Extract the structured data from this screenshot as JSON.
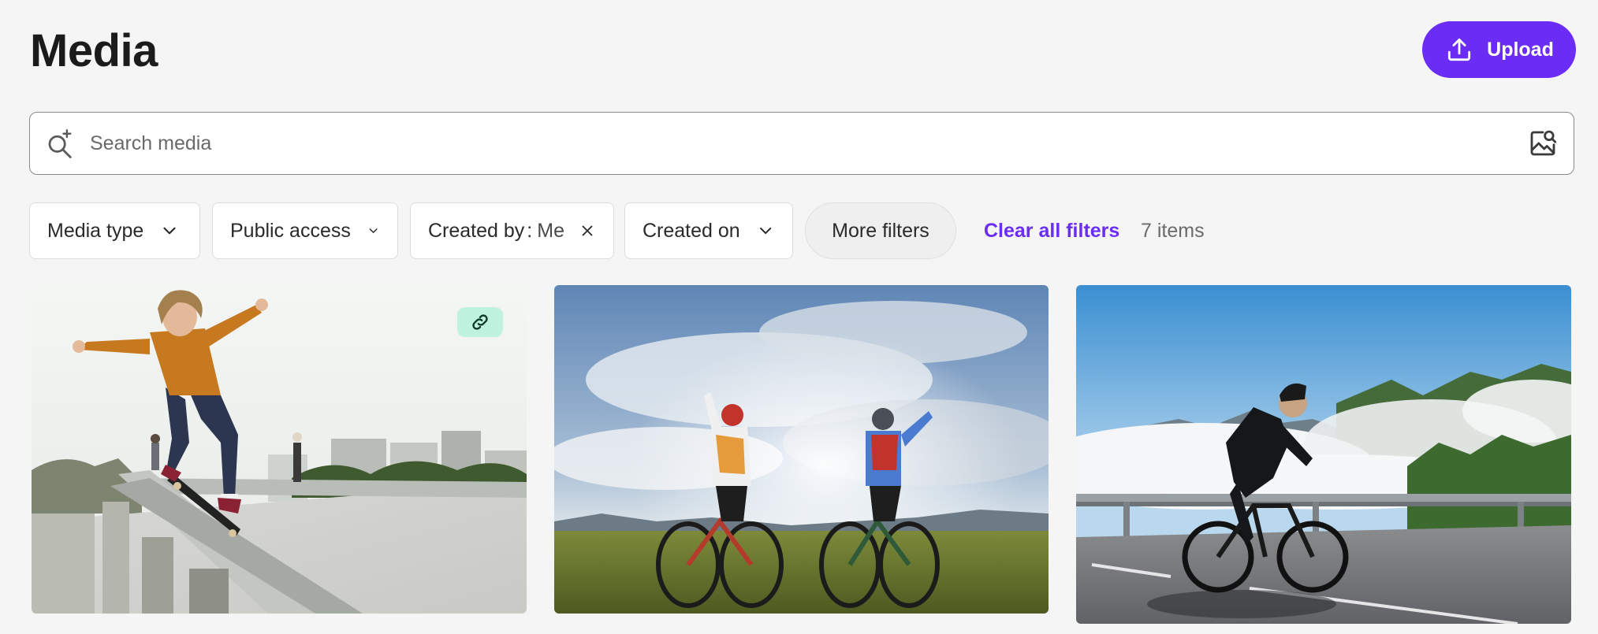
{
  "page": {
    "title": "Media"
  },
  "toolbar": {
    "upload_label": "Upload",
    "upload_icon": "upload-icon"
  },
  "search": {
    "placeholder": "Search media",
    "value": "",
    "leading_icon": "ai-search-icon",
    "trailing_icon": "image-search-icon"
  },
  "filters": {
    "media_type": {
      "label": "Media type",
      "icon": "chevron-down-icon"
    },
    "public_access": {
      "label": "Public access",
      "icon": "chevron-down-icon"
    },
    "created_by": {
      "label": "Created by",
      "separator": ":",
      "value": "Me",
      "icon": "close-icon"
    },
    "created_on": {
      "label": "Created on",
      "icon": "chevron-down-icon"
    },
    "more_filters": {
      "label": "More filters"
    },
    "clear_all": "Clear all filters",
    "item_count": "7 items"
  },
  "media_items": [
    {
      "subject": "skateboarder",
      "shared_link": true,
      "badge_icon": "link-icon"
    },
    {
      "subject": "two-cyclists-cheering",
      "shared_link": false
    },
    {
      "subject": "road-cyclist-mountains",
      "shared_link": false
    }
  ],
  "colors": {
    "accent": "#6b2cf5",
    "background": "#f5f5f5",
    "link_badge": "#bff3df"
  }
}
